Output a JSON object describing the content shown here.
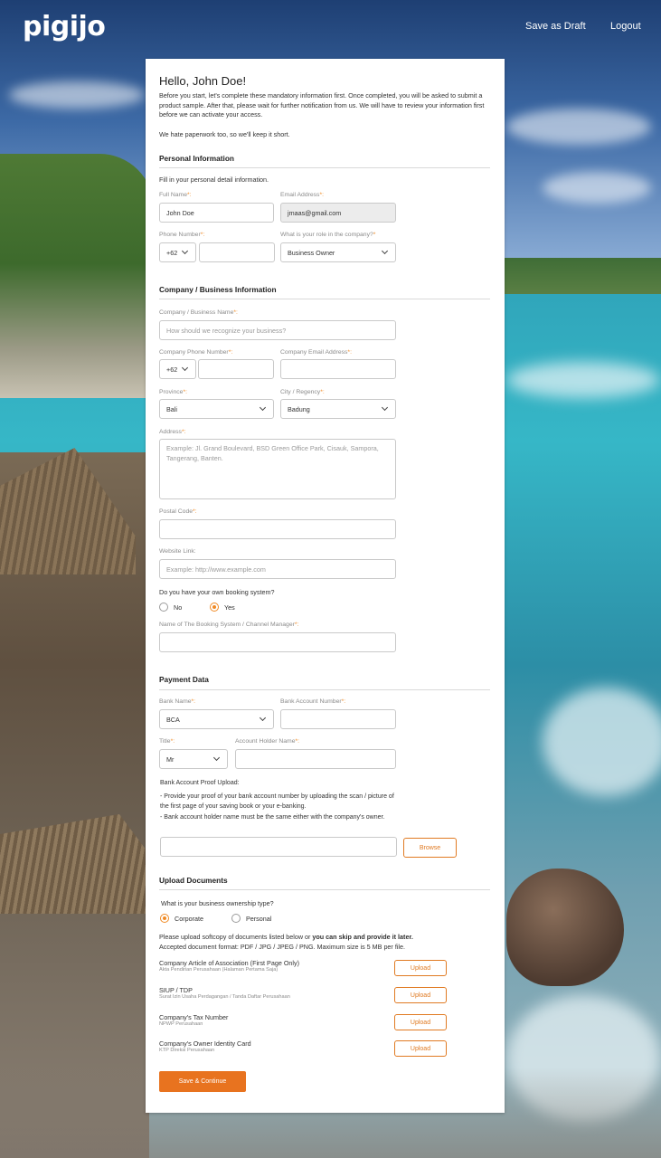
{
  "header": {
    "logo": "pigijo",
    "save_draft": "Save as Draft",
    "logout": "Logout"
  },
  "intro": {
    "greeting": "Hello, John Doe!",
    "text": "Before you start, let's complete these mandatory information first.  Once completed, you will be asked to submit a product sample.  After that, please wait for further notification from us.  We will have to review your information first before we can activate your access.",
    "note": "We hate paperwork too, so we'll keep it short."
  },
  "personal": {
    "title": "Personal Information",
    "help": "Fill in your personal detail information.",
    "full_name_label": "Full Name",
    "full_name_value": "John Doe",
    "email_label": "Email Address",
    "email_value": "jmaas@gmail.com",
    "phone_label": "Phone Number",
    "phone_code": "+62",
    "role_label": "What is your role in the company?",
    "role_value": "Business Owner"
  },
  "company": {
    "title": "Company / Business Information",
    "name_label": "Company /  Business Name",
    "name_placeholder": "How should we recognize your business?",
    "phone_label": "Company Phone Number",
    "phone_code": "+62",
    "email_label": "Company Email Address",
    "province_label": "Province",
    "province_value": "Bali",
    "city_label": "City / Regency",
    "city_value": "Badung",
    "address_label": "Address",
    "address_placeholder": "Example: Jl. Grand Boulevard, BSD Green Office Park, Cisauk, Sampora, Tangerang, Banten.",
    "postal_label": "Postal Code",
    "website_label": "Website Link:",
    "website_placeholder": "Example: http://www.example.com",
    "booking_question": "Do you have your own booking system?",
    "booking_no": "No",
    "booking_yes": "Yes",
    "booking_name_label": "Name of The Booking System / Channel Manager"
  },
  "payment": {
    "title": "Payment Data",
    "bank_label": "Bank Name",
    "bank_value": "BCA",
    "account_number_label": "Bank Account Number",
    "title_label": "Title",
    "title_value": "Mr",
    "holder_label": "Account Holder Name",
    "proof_label": "Bank Account Proof Upload:",
    "bullet1": "- Provide your proof of your bank account number by uploading the scan / picture of the first page of your saving book or your e-banking.",
    "bullet2": "- Bank account holder name must be the same either with the company's owner.",
    "browse": "Browse"
  },
  "documents": {
    "title": "Upload Documents",
    "ownership_question": "What is your business ownership type?",
    "corporate": "Corporate",
    "personal": "Personal",
    "note_prefix": "Please upload softcopy of documents listed below or ",
    "note_bold": "you can skip and provide it later.",
    "note_format": "Accepted document format: PDF / JPG / JPEG / PNG. Maximum size is 5 MB per file.",
    "items": [
      {
        "name": "Company Article of Association (First Page Only)",
        "sub": "Akta Pendirian Perusahaan (Halaman Pertama Saja)",
        "button": "Upload"
      },
      {
        "name": "SIUP / TDP",
        "sub": "Surat Izin Usaha Perdagangan / Tanda Daftar Perusahaan",
        "button": "Upload"
      },
      {
        "name": "Company's Tax Number",
        "sub": "NPWP Perusahaan",
        "button": "Upload"
      },
      {
        "name": "Company's Owner Identity Card",
        "sub": "KTP Direksi Perusahaan",
        "button": "Upload"
      }
    ],
    "submit": "Save & Continue"
  },
  "colors": {
    "accent": "#e8731f",
    "border": "#c9c9c9"
  }
}
